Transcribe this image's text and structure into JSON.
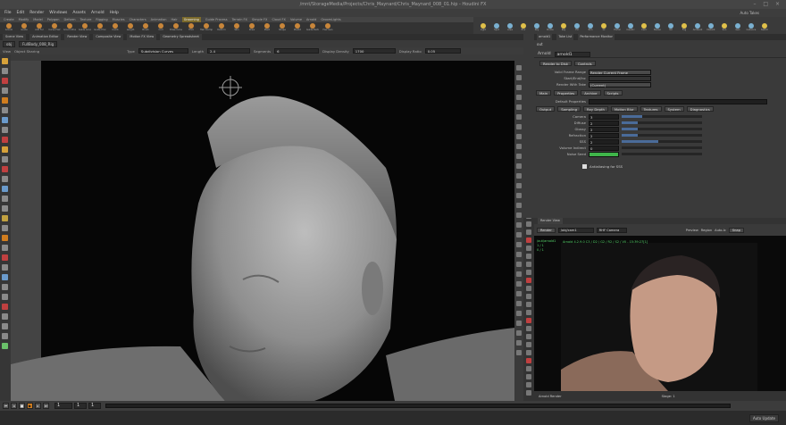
{
  "window": {
    "title": "/mnt/StorageMedia/Projects/Chris_Maynard/Chris_Maynard_008_01.hip - Houdini FX"
  },
  "menu": [
    "File",
    "Edit",
    "Render",
    "Windows",
    "Assets",
    "Arnold",
    "Help"
  ],
  "shelf_tabs": [
    "Create",
    "Modify",
    "Model",
    "Polygon",
    "Deform",
    "Texture",
    "Rigging",
    "Muscles",
    "Characters",
    "Animation",
    "Hair",
    "Grooming",
    "Guide Process",
    "Terrain FX",
    "Simple FX",
    "Cloud FX",
    "Volume",
    "Arnold",
    "GroomLights"
  ],
  "shelf_active_index": 11,
  "shelf_tools": [
    "Groom",
    "Guide",
    "Add Fur",
    "Curve Hair",
    "Groom Brush",
    "Guide Groom",
    "Guide Proc",
    "Comb",
    "Length",
    "Brush",
    "Curl",
    "Draw Curves",
    "Frizz",
    "Hair Clump",
    "Deform",
    "Skin",
    "Draw",
    "Plant",
    "Shape",
    "Plant2",
    "Guide Deform",
    "Hair Gen"
  ],
  "right_shelf_tools": [
    "Light",
    "Spot",
    "Area",
    "Env",
    "Sky",
    "Dome",
    "Key",
    "Fill",
    "Rim",
    "GI",
    "Portal",
    "Caustic",
    "Cam",
    "Stereo",
    "Vol",
    "Fog",
    "Ambient",
    "Distant",
    "Sun",
    "Geo",
    "Instance",
    "Switch"
  ],
  "auto_takes": "Auto Takes",
  "pane_tabs": [
    "Scene View",
    "Animation Editor",
    "Render View",
    "Composite View",
    "Motion FX View",
    "Geometry Spreadsheet"
  ],
  "path": {
    "obj": "obj",
    "node": "FullBody_008_Rig"
  },
  "viewport": {
    "view": "View",
    "sop": "Object Sharing"
  },
  "op_bar": {
    "type_label": "Type",
    "type_value": "Subdivision Curves",
    "length_label": "Length",
    "length_value": "2.4",
    "segments_label": "Segments",
    "segments_value": "6",
    "density_label": "Display Density",
    "density_value": "1700",
    "ratio_label": "Display Ratio",
    "ratio_value": "0.05"
  },
  "right_tabs": [
    "arnold1",
    "Take List",
    "Performance Monitor"
  ],
  "right_path": "out",
  "node": {
    "type": "Arnold",
    "name": "arnold1"
  },
  "render_buttons": [
    "Render to Disk",
    "Controls"
  ],
  "params_top": [
    {
      "label": "Valid Frame Range",
      "value": "Render Current Frame"
    },
    {
      "label": "Start/End/Inc",
      "value": ""
    },
    {
      "label": "Render With Take",
      "value": "(Current)"
    }
  ],
  "main_tabs": [
    "Main",
    "Properties",
    "Archive",
    "Scripts"
  ],
  "default_properties": "Default Properties",
  "sub_tabs": [
    "Output",
    "Sampling",
    "Ray Depth",
    "Motion Blur",
    "Textures",
    "System",
    "Diagnostics"
  ],
  "samples": [
    {
      "label": "Camera",
      "value": "3",
      "fill": 0.25
    },
    {
      "label": "Diffuse",
      "value": "2",
      "fill": 0.2
    },
    {
      "label": "Glossy",
      "value": "2",
      "fill": 0.2
    },
    {
      "label": "Refraction",
      "value": "2",
      "fill": 0.2
    },
    {
      "label": "SSS",
      "value": "2",
      "fill": 0.45
    },
    {
      "label": "Volume Indirect",
      "value": "0",
      "fill": 0
    },
    {
      "label": "Noise Seed",
      "value": "",
      "fill": 0
    }
  ],
  "adaptive_label": "Antialiasing for SSS",
  "render_view": {
    "tab": "Render View",
    "render_btn": "Render",
    "camera": "/obj/cam1",
    "renderer": "RHF Camera",
    "checks": [
      "Preview",
      "Region",
      "Auto-Ic"
    ],
    "snap": "Snap",
    "overlay_left": [
      "/out/arnold1",
      "1 / 1",
      "0 / 1"
    ],
    "overlay_info": "Arnold 4.2.9.0  C3 / D2 / G2 / R2 / S2 / V0 - 15:39:27[1]",
    "status": "Arnold Render",
    "stage": "Stage: 1"
  },
  "timeline": {
    "frame": "1",
    "start": "1",
    "end": "1",
    "auto_update": "Auto Update"
  },
  "colors": {
    "accent": "#d07d1f",
    "viewport_bg": "#060606",
    "bar": "#4a6b99"
  }
}
